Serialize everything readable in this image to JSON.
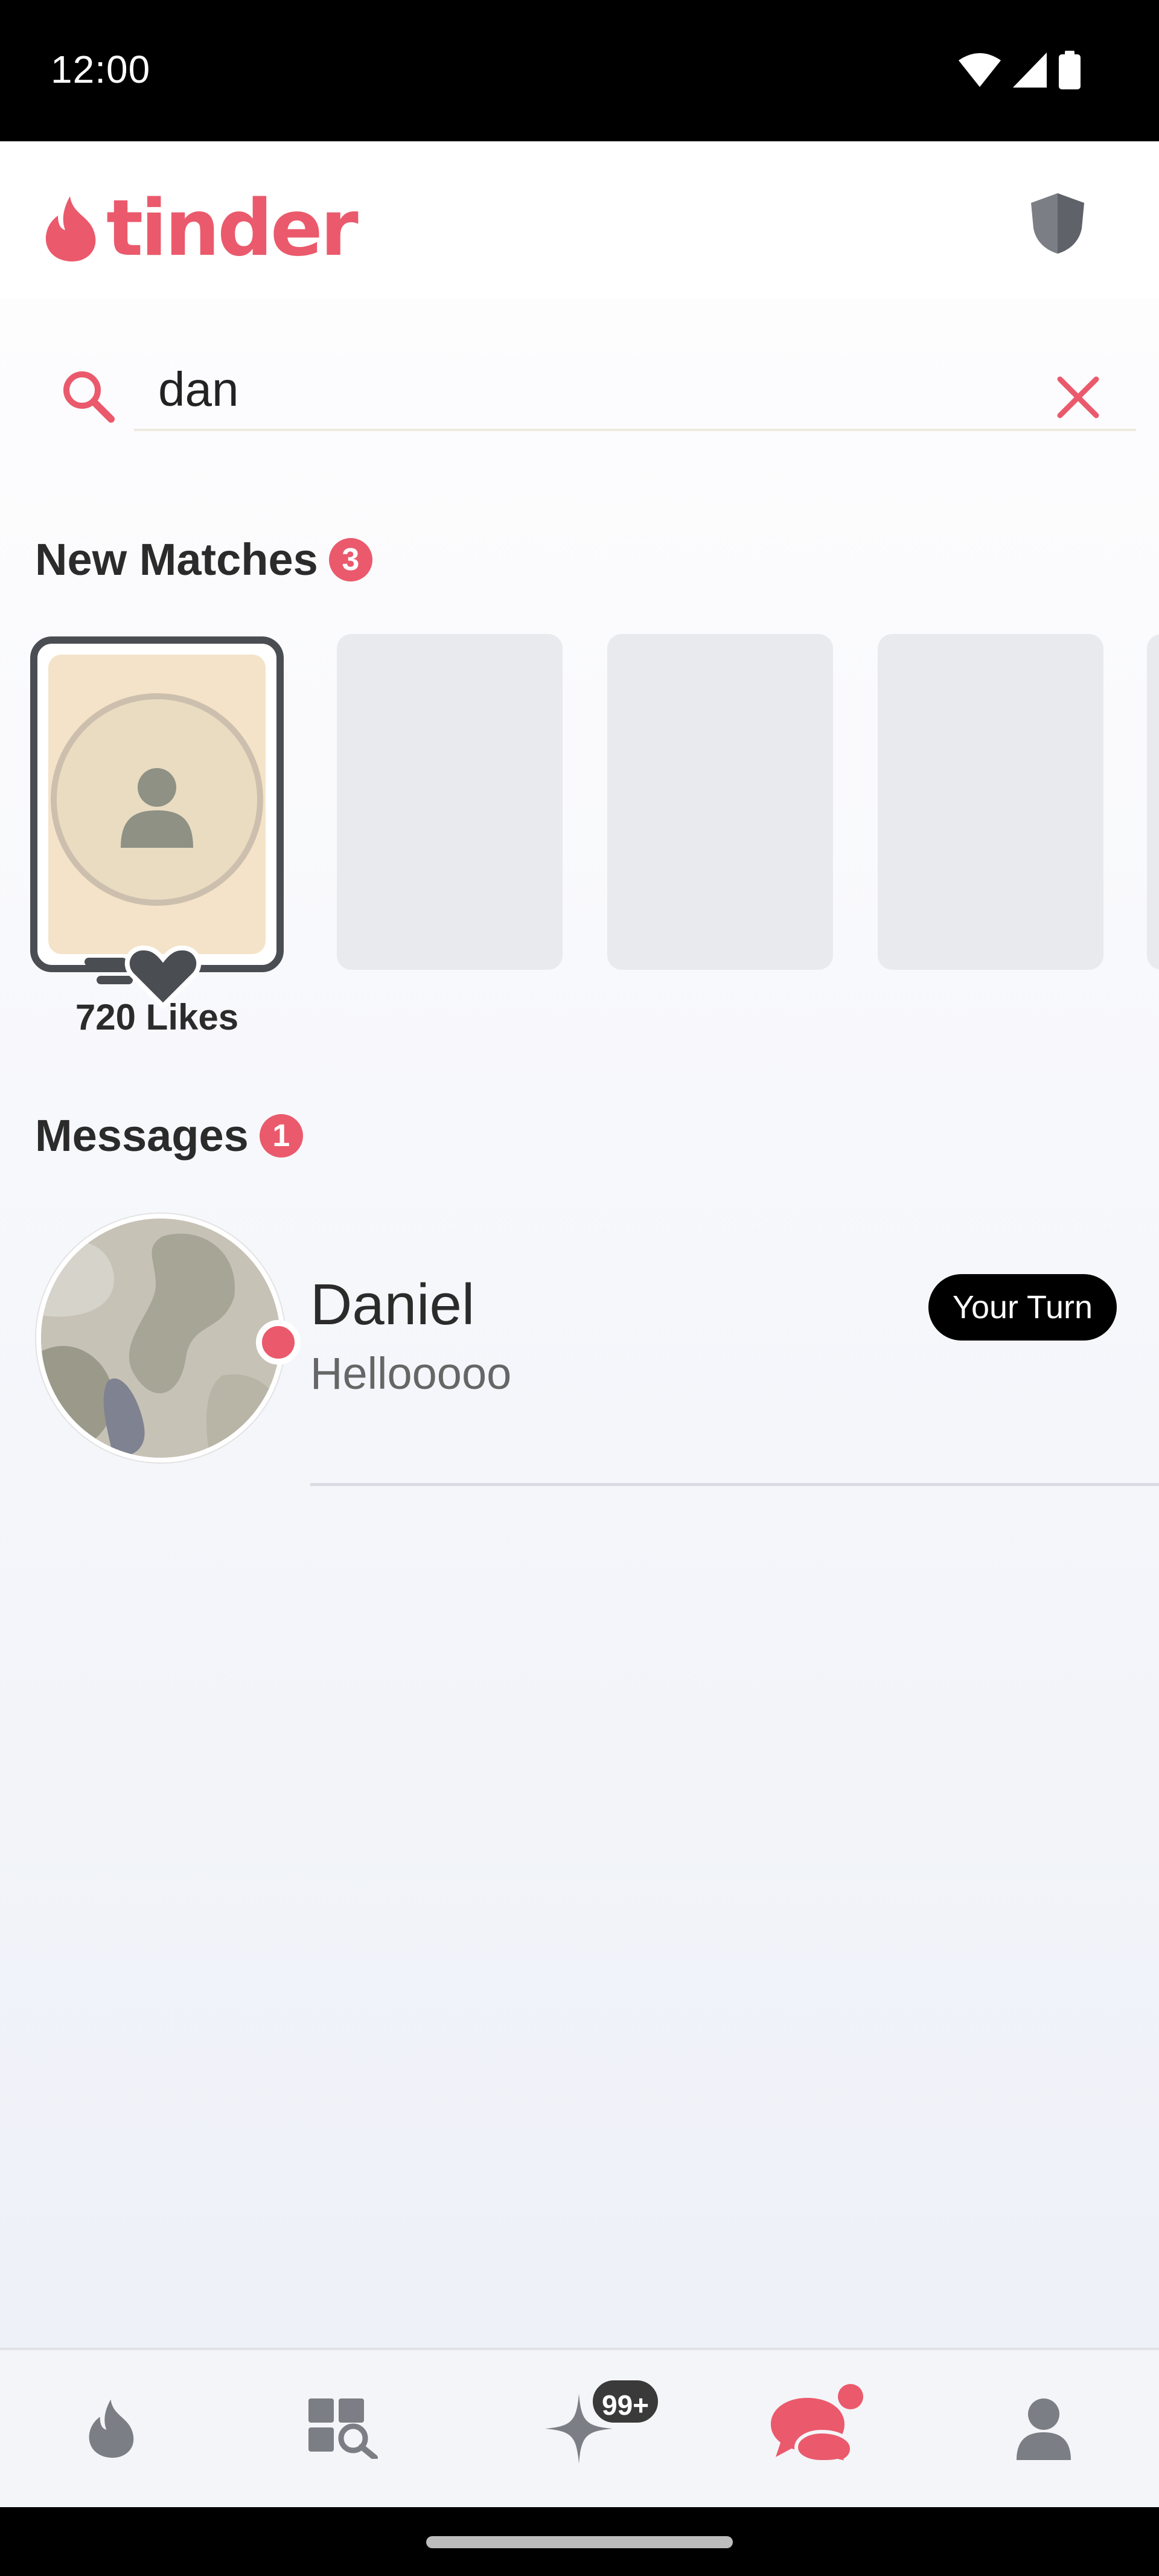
{
  "status_bar": {
    "time": "12:00"
  },
  "header": {
    "logo_text": "tinder"
  },
  "search": {
    "value": "dan",
    "placeholder": ""
  },
  "new_matches": {
    "title": "New Matches",
    "count": "3",
    "likes_label": "720 Likes"
  },
  "messages": {
    "title": "Messages",
    "count": "1",
    "items": [
      {
        "name": "Daniel",
        "preview": "Hellooooo",
        "badge": "Your Turn"
      }
    ]
  },
  "bottom_nav": {
    "gold_badge": "99+",
    "items": [
      "discover",
      "explore",
      "gold-home",
      "chat",
      "profile"
    ]
  },
  "colors": {
    "brand": "#ea5a6c",
    "icon_gray": "#7b7e84",
    "placeholder_card": "#e9eaed"
  }
}
